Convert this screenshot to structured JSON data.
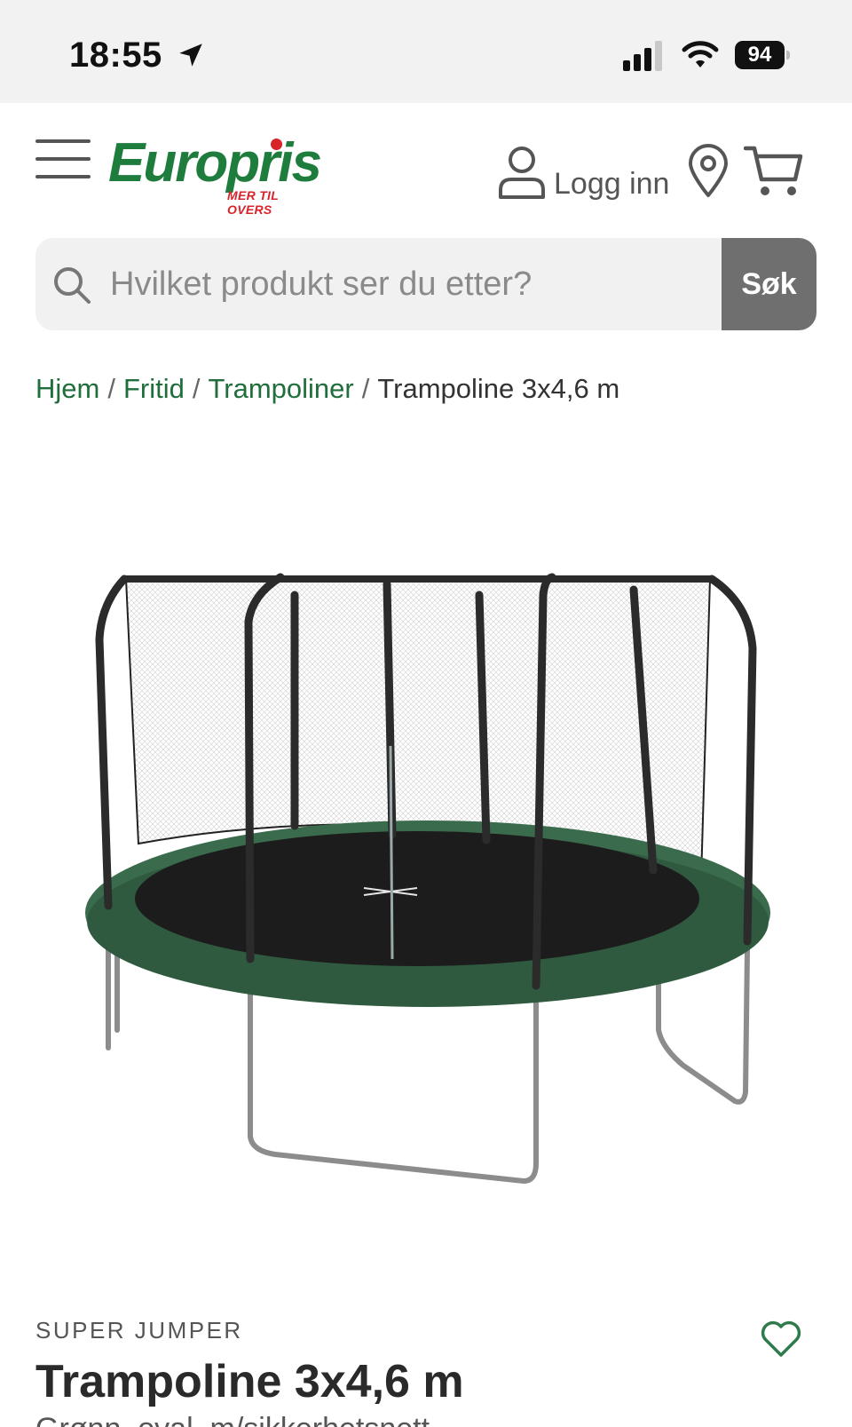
{
  "status_bar": {
    "time": "18:55",
    "battery": "94",
    "icons": [
      "location-arrow-icon",
      "cellular-signal-icon",
      "wifi-icon",
      "battery-icon"
    ]
  },
  "header": {
    "menu_icon": "hamburger-menu-icon",
    "logo": {
      "word": "Europris",
      "tagline": "MER TIL OVERS",
      "brand_color": "#1e7d3c",
      "accent_color": "#d8232a"
    },
    "login_label": "Logg inn",
    "icons": [
      "user-icon",
      "map-pin-icon",
      "shopping-cart-icon"
    ]
  },
  "search": {
    "placeholder": "Hvilket produkt ser du etter?",
    "value": "",
    "button_label": "Søk",
    "icon": "search-icon"
  },
  "breadcrumb": {
    "items": [
      {
        "label": "Hjem"
      },
      {
        "label": "Fritid"
      },
      {
        "label": "Trampoliner"
      }
    ],
    "separator": "/",
    "current": "Trampoline 3x4,6 m",
    "link_color": "#1f6e3c"
  },
  "product": {
    "image": "oval trampoline with safety net",
    "brand": "SUPER JUMPER",
    "title": "Trampoline 3x4,6 m",
    "subtitle": "Grønn, oval, m/sikkerhetsnett",
    "favorite_icon": "heart-outline-icon"
  }
}
